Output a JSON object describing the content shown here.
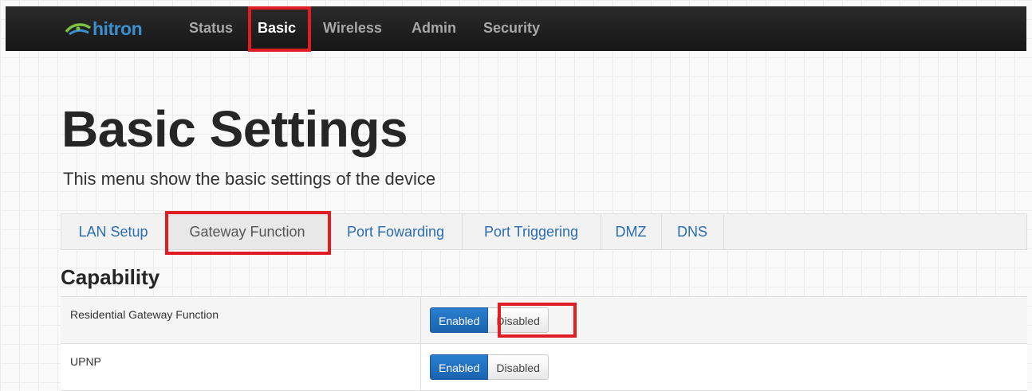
{
  "brand": {
    "name": "hitron",
    "accent": "#3a8fcf"
  },
  "nav": {
    "items": [
      {
        "label": "Status"
      },
      {
        "label": "Basic",
        "active": true
      },
      {
        "label": "Wireless"
      },
      {
        "label": "Admin"
      },
      {
        "label": "Security"
      }
    ]
  },
  "page": {
    "title": "Basic Settings",
    "subtitle": "This menu show the basic settings of the device"
  },
  "tabs": [
    {
      "label": "LAN Setup"
    },
    {
      "label": "Gateway Function",
      "active": true
    },
    {
      "label": "Port Fowarding"
    },
    {
      "label": "Port Triggering"
    },
    {
      "label": "DMZ"
    },
    {
      "label": "DNS"
    }
  ],
  "section": {
    "title": "Capability"
  },
  "settings": [
    {
      "label": "Residential Gateway Function",
      "enabled_label": "Enabled",
      "disabled_label": "Disabled"
    },
    {
      "label": "UPNP",
      "enabled_label": "Enabled",
      "disabled_label": "Disabled"
    }
  ],
  "colors": {
    "highlight": "#e11d24",
    "primary_button": "#1a63ae",
    "link": "#2a6db0"
  }
}
